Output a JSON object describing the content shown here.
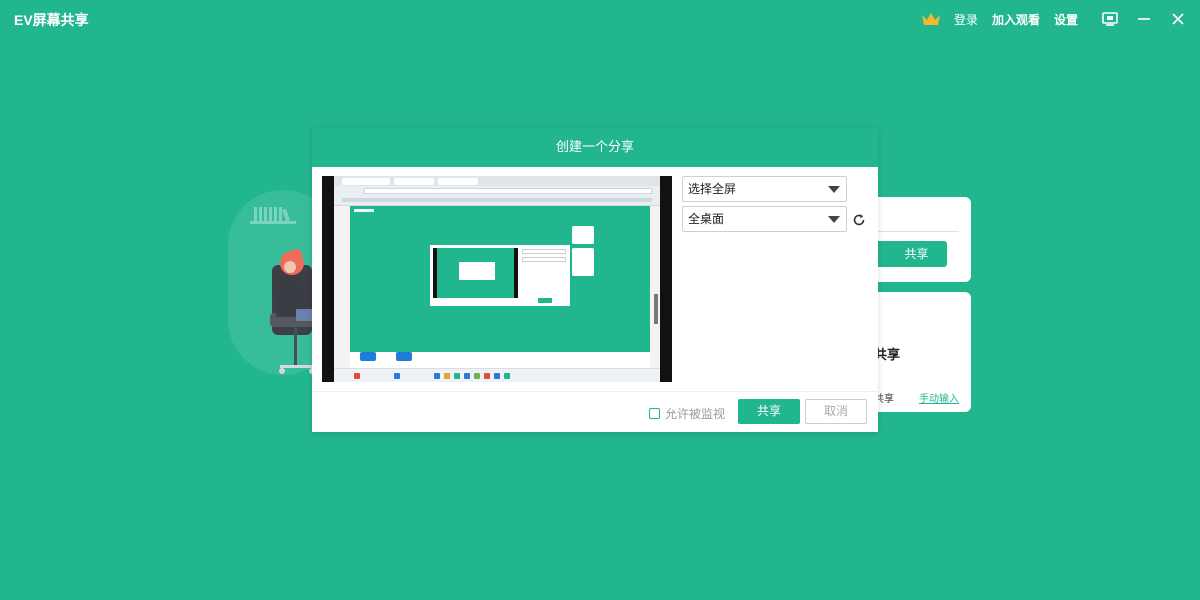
{
  "app": {
    "title": "EV屏幕共享"
  },
  "topbar": {
    "login": "登录",
    "join_watch": "加入观看",
    "settings": "设置"
  },
  "modal": {
    "title": "创建一个分享",
    "capture_mode": {
      "selected": "选择全屏"
    },
    "screen_select": {
      "selected": "全桌面"
    },
    "allow_monitor": {
      "label": "允许被监视",
      "checked": false
    },
    "share_label": "共享",
    "cancel_label": "取消"
  },
  "background_cards": {
    "card_top": {
      "button_label": "共享"
    },
    "card_bottom": {
      "title": "共享",
      "subtitle": "共享",
      "manual_input": "手动输入"
    }
  },
  "colors": {
    "accent": "#22b68f",
    "crown": "#f5b72f"
  },
  "icons": [
    "crown-icon",
    "monitor-icon",
    "minimize-icon",
    "close-icon",
    "chevron-down-icon",
    "refresh-icon"
  ]
}
